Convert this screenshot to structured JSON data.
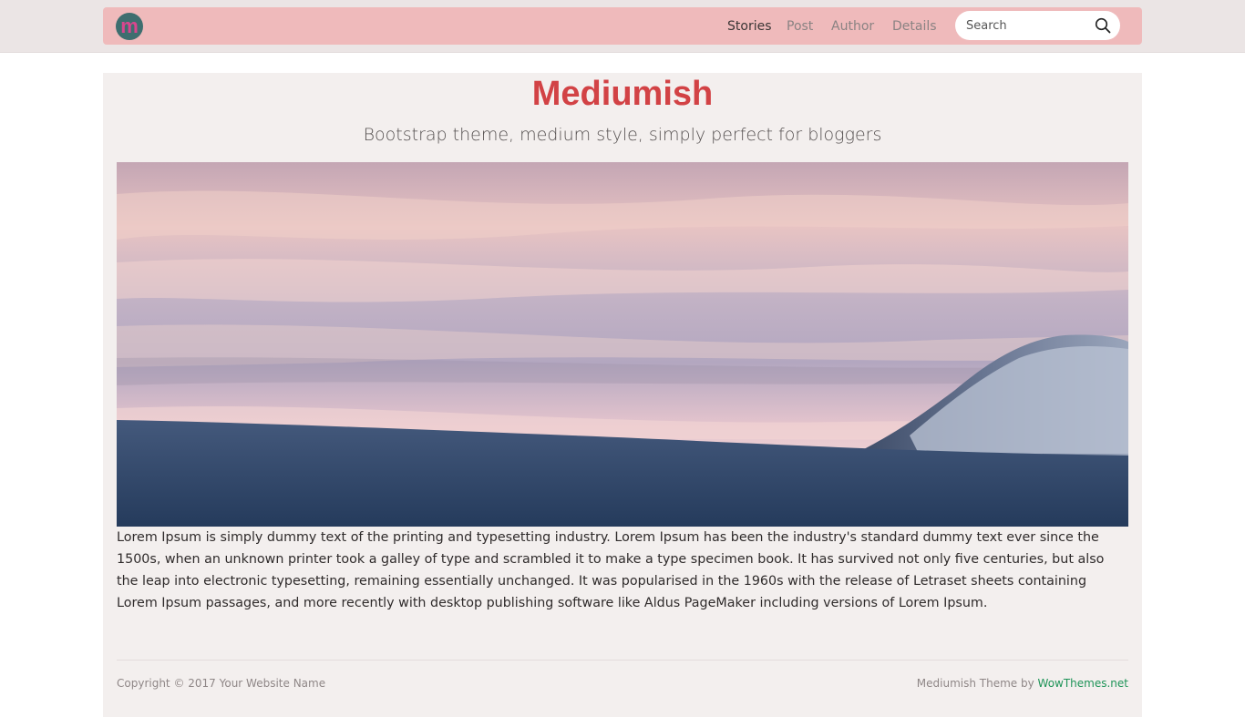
{
  "nav": {
    "logo_alt": "Mediumish logo",
    "items": [
      {
        "label": "Stories",
        "active": true
      },
      {
        "label": "Post",
        "active": false
      },
      {
        "label": "Author",
        "active": false
      },
      {
        "label": "Details",
        "active": false
      }
    ],
    "search_placeholder": "Search",
    "search_icon": "search-icon"
  },
  "header": {
    "title": "Mediumish",
    "tagline": "Bootstrap theme, medium style, simply perfect for bloggers"
  },
  "article": {
    "body": "Lorem Ipsum is simply dummy text of the printing and typesetting industry. Lorem Ipsum has been the industry's standard dummy text ever since the 1500s, when an unknown printer took a galley of type and scrambled it to make a type specimen book. It has survived not only five centuries, but also the leap into electronic typesetting, remaining essentially unchanged. It was popularised in the 1960s with the release of Letraset sheets containing Lorem Ipsum passages, and more recently with desktop publishing software like Aldus PageMaker including versions of Lorem Ipsum."
  },
  "footer": {
    "copyright": "Copyright © 2017 Your Website Name",
    "credit_prefix": "Mediumish Theme by ",
    "credit_link": "WowThemes.net"
  },
  "colors": {
    "navbar": "#efbabb",
    "title": "#d24245",
    "link": "#1f9458",
    "card": "#f3efee"
  }
}
